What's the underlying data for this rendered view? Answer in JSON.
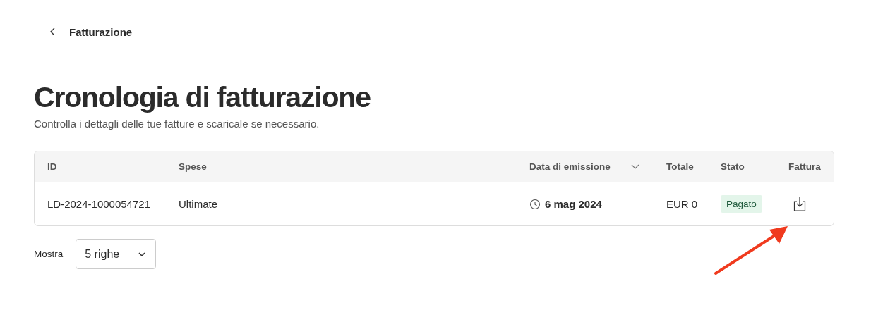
{
  "breadcrumb": {
    "label": "Fatturazione"
  },
  "title": "Cronologia di fatturazione",
  "subtitle": "Controlla i dettagli delle tue fatture e scaricale se necessario.",
  "table": {
    "columns": [
      {
        "label": "ID",
        "sorted": false
      },
      {
        "label": "Spese",
        "sorted": false
      },
      {
        "label": "Data di emissione",
        "sorted": true
      },
      {
        "label": "Totale",
        "sorted": false
      },
      {
        "label": "Stato",
        "sorted": false
      },
      {
        "label": "Fattura",
        "sorted": false
      }
    ],
    "rows": [
      {
        "id": "LD-2024-1000054721",
        "charges": "Ultimate",
        "date": "6 mag 2024",
        "total": "EUR 0",
        "status": {
          "label": "Pagato",
          "kind": "paid"
        }
      }
    ]
  },
  "pagination": {
    "label": "Mostra",
    "value": "5 righe"
  }
}
